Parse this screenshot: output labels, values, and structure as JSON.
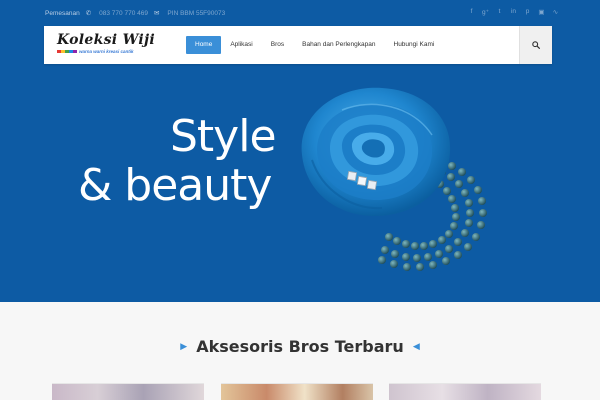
{
  "topbar": {
    "label": "Pemesanan",
    "phone": "083 770 770 469",
    "pin": "PIN BBM 55F90073",
    "social_icons": [
      "facebook-icon",
      "google-plus-icon",
      "twitter-icon",
      "linkedin-icon",
      "pinterest-icon",
      "instagram-icon",
      "rss-icon"
    ]
  },
  "logo": {
    "brand": "Koleksi Wiji",
    "tagline": "warna warni kreasi cantik"
  },
  "nav": {
    "items": [
      {
        "label": "Home",
        "active": true
      },
      {
        "label": "Aplikasi",
        "active": false
      },
      {
        "label": "Bros",
        "active": false
      },
      {
        "label": "Bahan dan Perlengkapan",
        "active": false
      },
      {
        "label": "Hubungi Kami",
        "active": false
      }
    ]
  },
  "hero": {
    "line1": "Style",
    "line2": "& beauty"
  },
  "section": {
    "title": "Aksesoris Bros Terbaru"
  },
  "colors": {
    "hero_blue": "#0d5ba4",
    "accent": "#3a8fd8"
  }
}
